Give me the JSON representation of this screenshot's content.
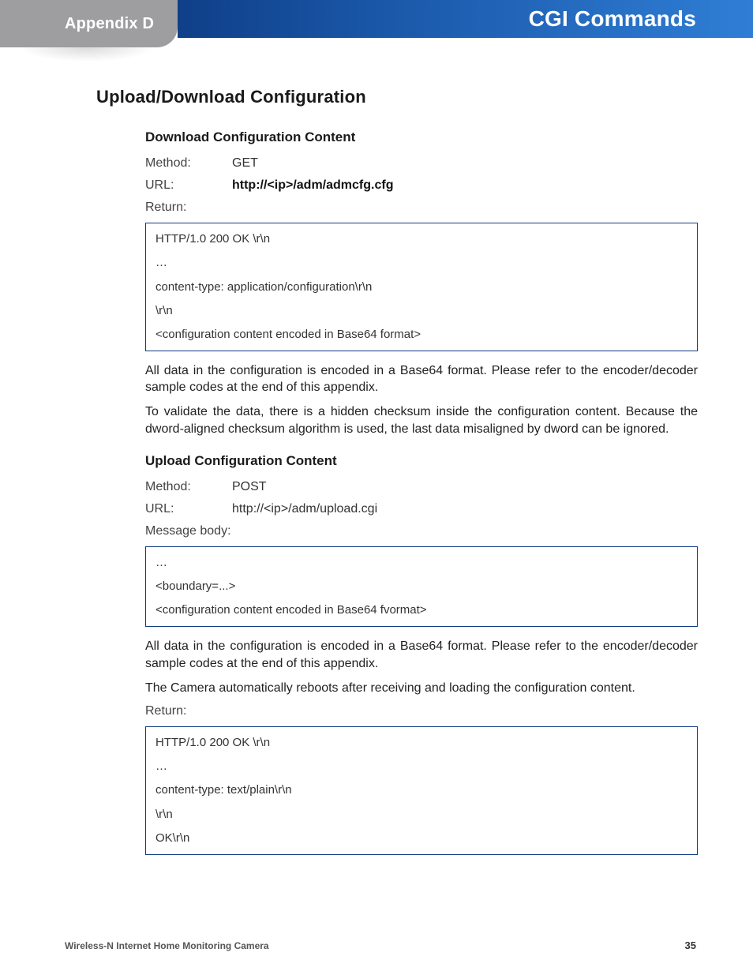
{
  "header": {
    "appendix": "Appendix D",
    "title": "CGI Commands"
  },
  "section": {
    "heading": "Upload/Download Configuration",
    "download": {
      "heading": "Download Configuration Content",
      "method_label": "Method:",
      "method_value": "GET",
      "url_label": "URL:",
      "url_value": "http://<ip>/adm/admcfg.cfg",
      "return_label": "Return:",
      "code": {
        "l1": "HTTP/1.0 200 OK \\r\\n",
        "l2": "…",
        "l3": "content-type: application/configuration\\r\\n",
        "l4": "\\r\\n",
        "l5": "<configuration content encoded in Base64 format>"
      },
      "para1": "All data in the configuration is encoded in a Base64 format. Please refer to the encoder/decoder sample codes at the end of this appendix.",
      "para2": "To validate the data, there is a hidden checksum inside the configuration content. Because the dword-aligned checksum algorithm is used, the last data misaligned by dword can be ignored."
    },
    "upload": {
      "heading": "Upload Configuration Content",
      "method_label": "Method:",
      "method_value": "POST",
      "url_label": "URL:",
      "url_value": "http://<ip>/adm/upload.cgi",
      "msg_label": "Message body:",
      "code1": {
        "l1": "…",
        "l2": "<boundary=...>",
        "l3": "<configuration content encoded in Base64 fvormat>"
      },
      "para1": "All data in the configuration is encoded in a Base64 format. Please refer to the encoder/decoder sample codes at the end of this appendix.",
      "para2": "The Camera automatically reboots after receiving and loading the configuration content.",
      "return_label": "Return:",
      "code2": {
        "l1": "HTTP/1.0 200 OK \\r\\n",
        "l2": "…",
        "l3": "content-type: text/plain\\r\\n",
        "l4": "\\r\\n",
        "l5": "OK\\r\\n"
      }
    }
  },
  "footer": {
    "product": "Wireless-N Internet Home Monitoring Camera",
    "page_number": "35"
  }
}
